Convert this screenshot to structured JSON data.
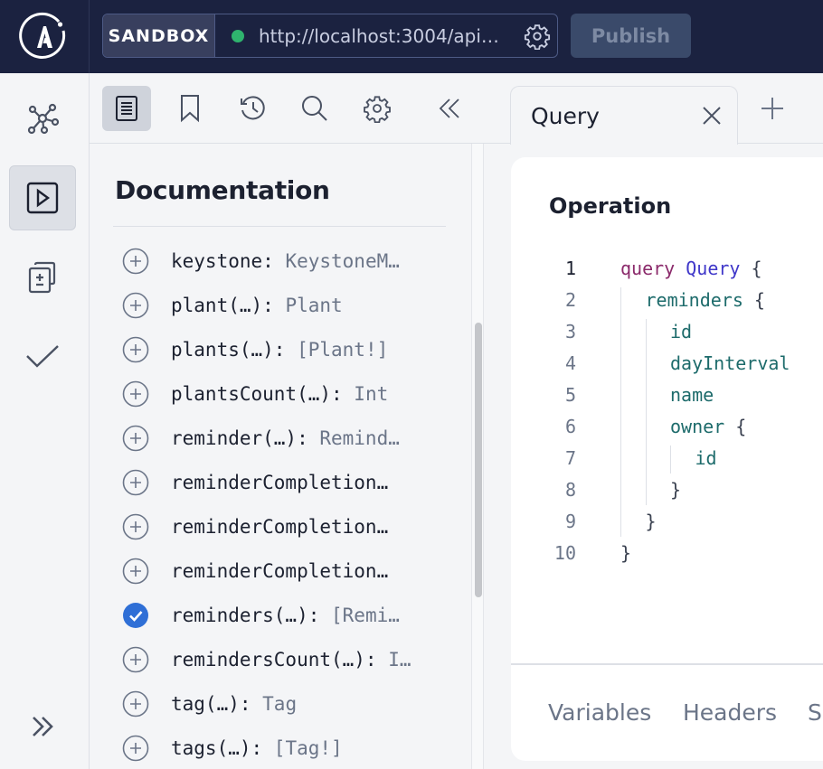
{
  "header": {
    "logo": "apollo-logo-icon",
    "environment_label": "SANDBOX",
    "endpoint_status_color": "#2fb36e",
    "endpoint_url": "http://localhost:3004/api…",
    "publish_label": "Publish"
  },
  "left_nav": {
    "items": [
      {
        "name": "schema",
        "icon": "graph-icon",
        "active": false
      },
      {
        "name": "explorer",
        "icon": "play-icon",
        "active": true
      },
      {
        "name": "changes",
        "icon": "diff-icon",
        "active": false
      },
      {
        "name": "checks",
        "icon": "check-icon",
        "active": false
      }
    ],
    "expand_icon": "chevron-double-right-icon"
  },
  "doc_toolbar": {
    "items": [
      {
        "name": "documentation",
        "icon": "document-icon",
        "active": true
      },
      {
        "name": "collections",
        "icon": "bookmark-icon",
        "active": false
      },
      {
        "name": "history",
        "icon": "history-icon",
        "active": false
      },
      {
        "name": "search",
        "icon": "search-icon",
        "active": false
      },
      {
        "name": "settings",
        "icon": "gear-icon",
        "active": false
      },
      {
        "name": "collapse",
        "icon": "chevron-double-left-icon",
        "active": false
      }
    ]
  },
  "documentation": {
    "title": "Documentation",
    "fields": [
      {
        "name": "keystone:",
        "type": "KeystoneM…",
        "selected": false
      },
      {
        "name": "plant(…):",
        "type": "Plant",
        "selected": false
      },
      {
        "name": "plants(…):",
        "type": "[Plant!]",
        "selected": false
      },
      {
        "name": "plantsCount(…):",
        "type": "Int",
        "selected": false
      },
      {
        "name": "reminder(…):",
        "type": "Remind…",
        "selected": false
      },
      {
        "name": "reminderCompletion…",
        "type": "",
        "selected": false
      },
      {
        "name": "reminderCompletion…",
        "type": "",
        "selected": false
      },
      {
        "name": "reminderCompletion…",
        "type": "",
        "selected": false
      },
      {
        "name": "reminders(…):",
        "type": "[Remi…",
        "selected": true
      },
      {
        "name": "remindersCount(…):",
        "type": "I…",
        "selected": false
      },
      {
        "name": "tag(…):",
        "type": "Tag",
        "selected": false
      },
      {
        "name": "tags(…):",
        "type": "[Tag!]",
        "selected": false
      }
    ]
  },
  "tabs": {
    "items": [
      {
        "label": "Query"
      }
    ],
    "add_icon": "plus-icon"
  },
  "operation": {
    "title": "Operation",
    "lines": [
      {
        "n": "1",
        "tokens": [
          {
            "t": "query",
            "c": "kw"
          },
          {
            "t": " ",
            "c": "punc"
          },
          {
            "t": "Query",
            "c": "opname"
          },
          {
            "t": " {",
            "c": "punc"
          }
        ],
        "indent": 0
      },
      {
        "n": "2",
        "tokens": [
          {
            "t": "reminders",
            "c": "fld"
          },
          {
            "t": " {",
            "c": "punc"
          }
        ],
        "indent": 1
      },
      {
        "n": "3",
        "tokens": [
          {
            "t": "id",
            "c": "fld"
          }
        ],
        "indent": 2
      },
      {
        "n": "4",
        "tokens": [
          {
            "t": "dayInterval",
            "c": "fld"
          }
        ],
        "indent": 2
      },
      {
        "n": "5",
        "tokens": [
          {
            "t": "name",
            "c": "fld"
          }
        ],
        "indent": 2
      },
      {
        "n": "6",
        "tokens": [
          {
            "t": "owner",
            "c": "fld"
          },
          {
            "t": " {",
            "c": "punc"
          }
        ],
        "indent": 2
      },
      {
        "n": "7",
        "tokens": [
          {
            "t": "id",
            "c": "fld"
          }
        ],
        "indent": 3
      },
      {
        "n": "8",
        "tokens": [
          {
            "t": "}",
            "c": "punc"
          }
        ],
        "indent": 2
      },
      {
        "n": "9",
        "tokens": [
          {
            "t": "}",
            "c": "punc"
          }
        ],
        "indent": 1
      },
      {
        "n": "10",
        "tokens": [
          {
            "t": "}",
            "c": "punc"
          }
        ],
        "indent": 0
      }
    ],
    "current_line": "1"
  },
  "bottom_tabs": {
    "variables": "Variables",
    "headers": "Headers",
    "third": "S"
  }
}
